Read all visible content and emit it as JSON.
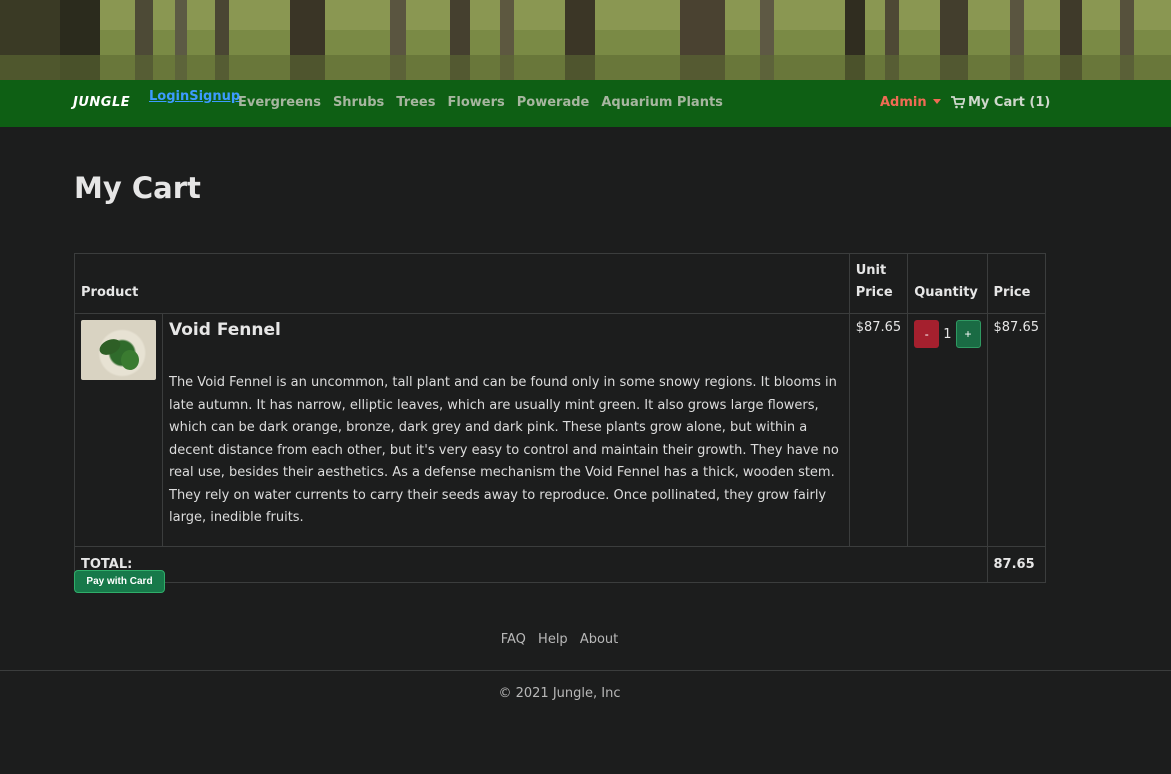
{
  "navbar": {
    "brand": "JUNGLE",
    "login": "Login",
    "signup": "Signup",
    "links": [
      "Evergreens",
      "Shrubs",
      "Trees",
      "Flowers",
      "Powerade",
      "Aquarium Plants"
    ],
    "admin": "Admin",
    "cart": "My Cart (1)"
  },
  "page": {
    "title": "My Cart"
  },
  "table": {
    "headers": {
      "product": "Product",
      "unit_price": "Unit Price",
      "quantity": "Quantity",
      "price": "Price"
    },
    "items": [
      {
        "name": "Void Fennel",
        "description": "The Void Fennel is an uncommon, tall plant and can be found only in some snowy regions. It blooms in late autumn. It has narrow, elliptic leaves, which are usually mint green. It also grows large flowers, which can be dark orange, bronze, dark grey and dark pink. These plants grow alone, but within a decent distance from each other, but it's very easy to control and maintain their growth. They have no real use, besides their aesthetics. As a defense mechanism the Void Fennel has a thick, wooden stem. They rely on water currents to carry their seeds away to reproduce. Once pollinated, they grow fairly large, inedible fruits.",
        "unit_price": "$87.65",
        "minus": "-",
        "quantity": "1",
        "plus": "+",
        "price": "$87.65"
      }
    ],
    "total_label": "TOTAL:",
    "total_value": "87.65"
  },
  "pay_button": "Pay with Card",
  "footer": {
    "links": [
      "FAQ",
      "Help",
      "About"
    ],
    "copyright": "© 2021 Jungle, Inc"
  },
  "colors": {
    "navbar": "#0e5f14",
    "background": "#1c1d1d",
    "admin": "#f06b54",
    "link": "#3d9bff",
    "minus_button": "#a5202e",
    "plus_button": "#1a6b44"
  }
}
